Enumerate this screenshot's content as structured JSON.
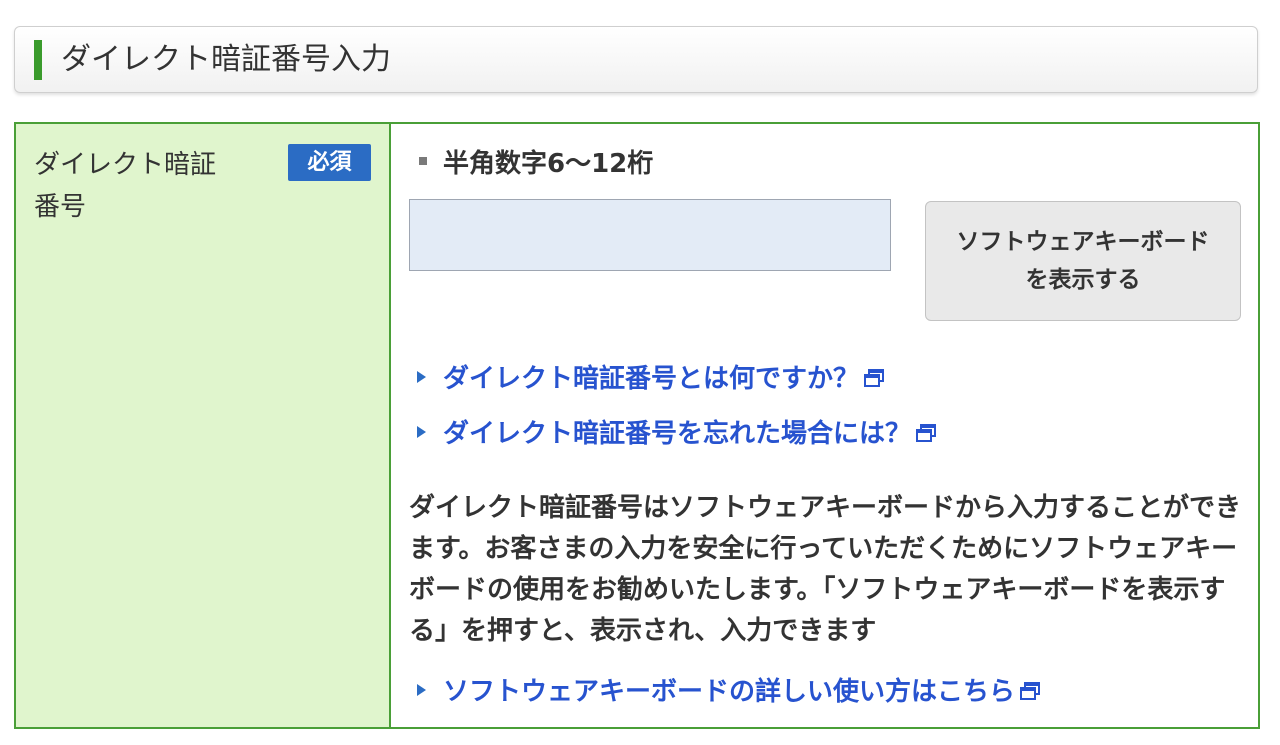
{
  "header": {
    "title": "ダイレクト暗証番号入力",
    "accent_color": "#3a9b2c"
  },
  "form": {
    "label_line1": "ダイレクト暗証",
    "label_line2": "番号",
    "required_badge": "必須",
    "hint": "半角数字6〜12桁",
    "pin_input": {
      "value": "",
      "placeholder": ""
    },
    "keyboard_button_line1": "ソフトウェアキーボード",
    "keyboard_button_line2": "を表示する",
    "links": [
      {
        "label": "ダイレクト暗証番号とは何ですか？",
        "icon": "external-window-icon"
      },
      {
        "label": "ダイレクト暗証番号を忘れた場合には？",
        "icon": "external-window-icon"
      }
    ],
    "description": "ダイレクト暗証番号はソフトウェアキーボードから入力することができます。お客さまの入力を安全に行っていただくためにソフトウェアキーボードの使用をお勧めいたします。「ソフトウェアキーボードを表示する」を押すと、表示され、入力できます",
    "help_link": {
      "label": "ソフトウェアキーボードの詳しい使い方はこちら",
      "icon": "external-window-icon"
    }
  },
  "colors": {
    "border_green": "#4a9f37",
    "label_bg": "#e0f5cd",
    "badge_blue": "#2b6cc4",
    "link_blue": "#2753cf",
    "input_bg": "#e3ebf6"
  }
}
